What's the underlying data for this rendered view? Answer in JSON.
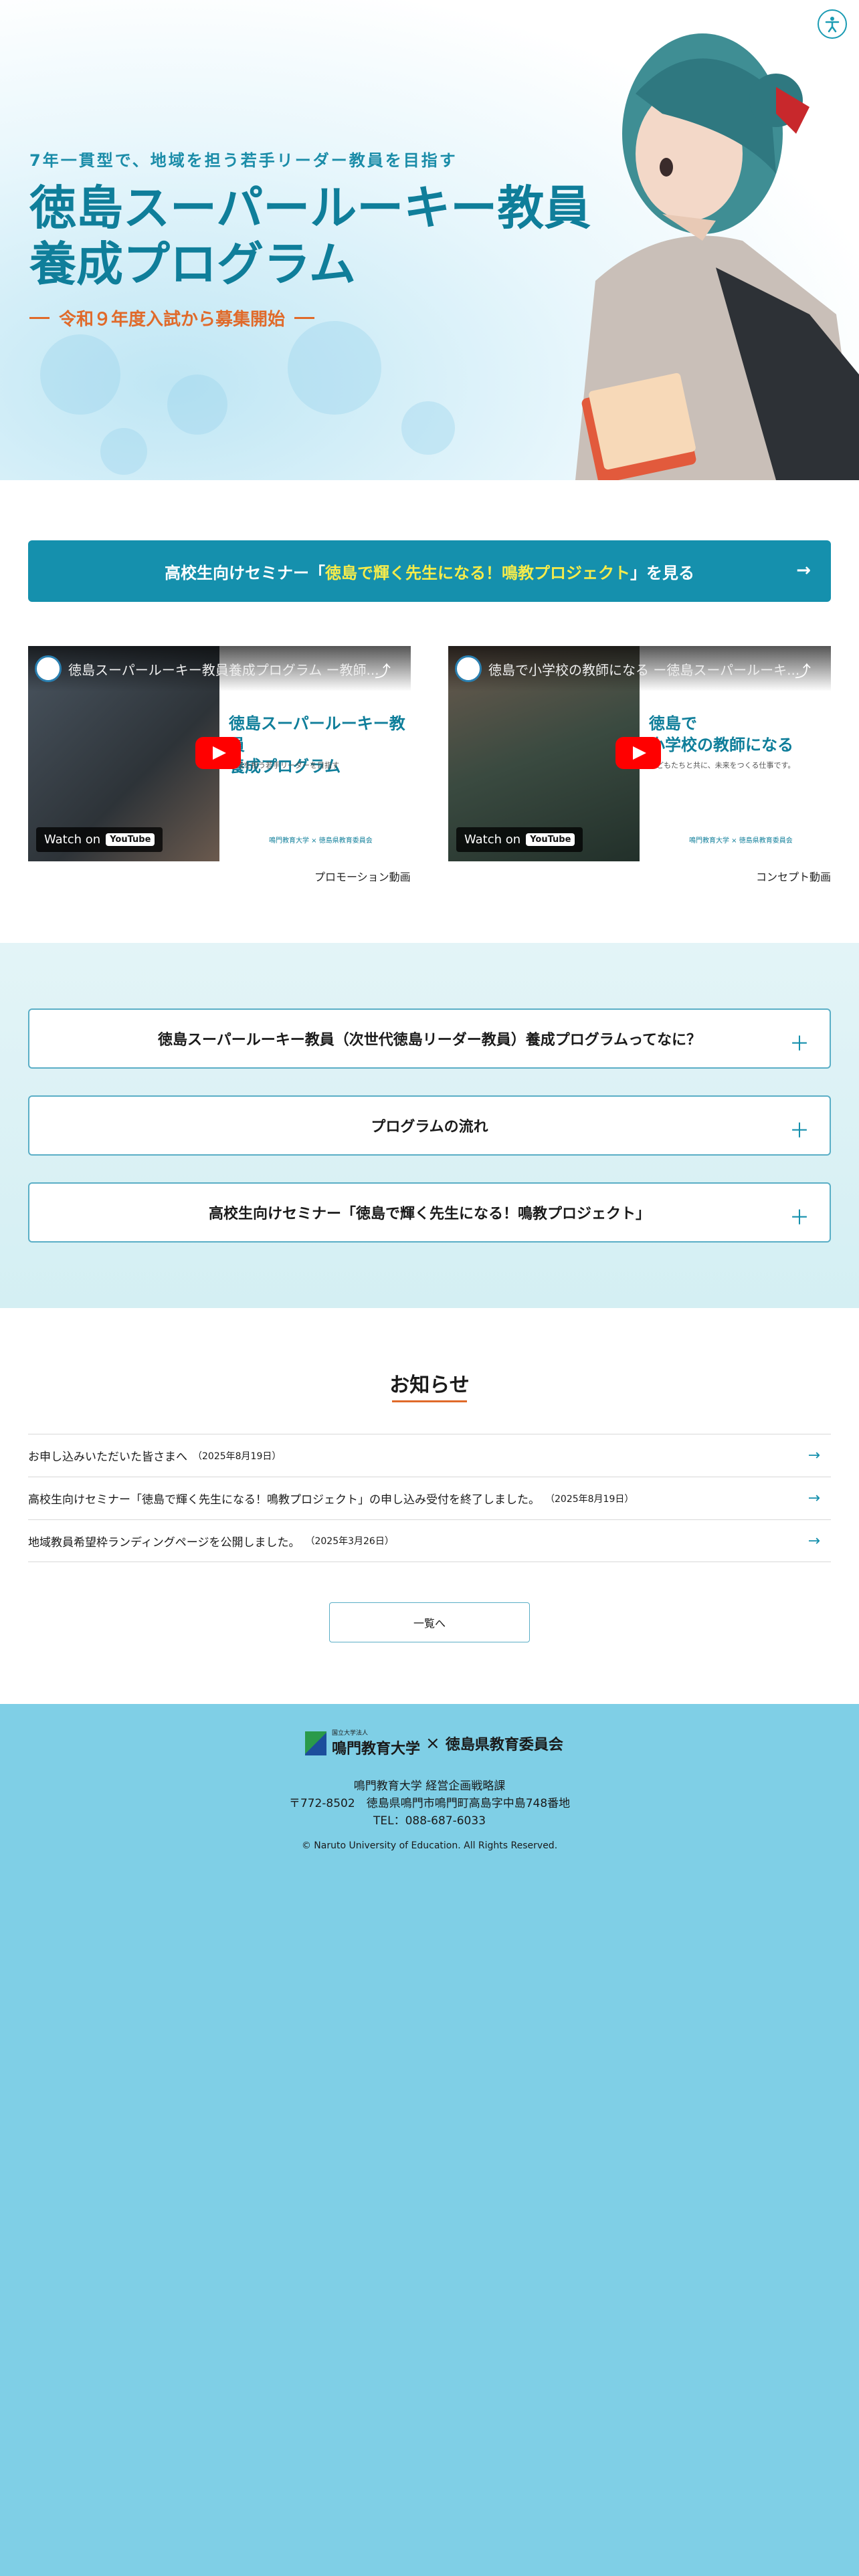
{
  "hero": {
    "subtitle": "7年一貫型で、地域を担う若手リーダー教員を目指す",
    "title_line1": "徳島スーパールーキー教員",
    "title_line2": "養成プログラム",
    "announcement": "令和９年度入試から募集開始",
    "accessibility_icon": "accessibility-icon"
  },
  "seminar_button": {
    "prefix": "高校生向けセミナー「",
    "highlight": "徳島で輝く先生になる！鳴教プロジェクト",
    "suffix": "」を見る",
    "arrow": "→"
  },
  "videos": [
    {
      "title": "徳島スーパールーキー教員養成プログラム ー教師...",
      "card_title_1": "徳島スーパールーキー教員",
      "card_title_2": "養成プログラム",
      "card_sub": "地域を担う若手リーダーを目指す",
      "card_foot": "鳴門教育大学 × 徳島県教育委員会",
      "watch": "Watch on",
      "yt": "YouTube",
      "caption": "プロモーション動画"
    },
    {
      "title": "徳島で小学校の教師になる ー徳島スーパールーキ...",
      "card_title_1": "徳島で",
      "card_title_2": "小学校の教師になる",
      "card_sub": "子どもたちと共に、未来をつくる仕事です。",
      "card_foot": "鳴門教育大学 × 徳島県教育委員会",
      "watch": "Watch on",
      "yt": "YouTube",
      "caption": "コンセプト動画"
    }
  ],
  "accordions": [
    "徳島スーパールーキー教員（次世代徳島リーダー教員）養成プログラムってなに？",
    "プログラムの流れ",
    "高校生向けセミナー「徳島で輝く先生になる！鳴教プロジェクト」"
  ],
  "news": {
    "title": "お知らせ",
    "items": [
      {
        "text": "お申し込みいただいた皆さまへ",
        "date": "（2025年8月19日）"
      },
      {
        "text": "高校生向けセミナー「徳島で輝く先生になる！鳴教プロジェクト」の申し込み受付を終了しました。",
        "date": "（2025年8月19日）"
      },
      {
        "text": "地域教員希望枠ランディングページを公開しました。",
        "date": "（2025年3月26日）"
      }
    ],
    "more": "一覧へ"
  },
  "footer": {
    "uni_small": "国立大学法人",
    "uni": "鳴門教育大学",
    "x": "×",
    "board": "徳島県教育委員会",
    "dept": "鳴門教育大学 経営企画戦略課",
    "address": "〒772-8502　徳島県鳴門市鳴門町高島字中島748番地",
    "tel": "TEL：088-687-6033",
    "copyright": "© Naruto University of Education. All Rights Reserved."
  },
  "colors": {
    "accent": "#1590ad",
    "orange": "#e06a2a",
    "highlight": "#f7ec4a",
    "footer": "#7fcfe6"
  }
}
